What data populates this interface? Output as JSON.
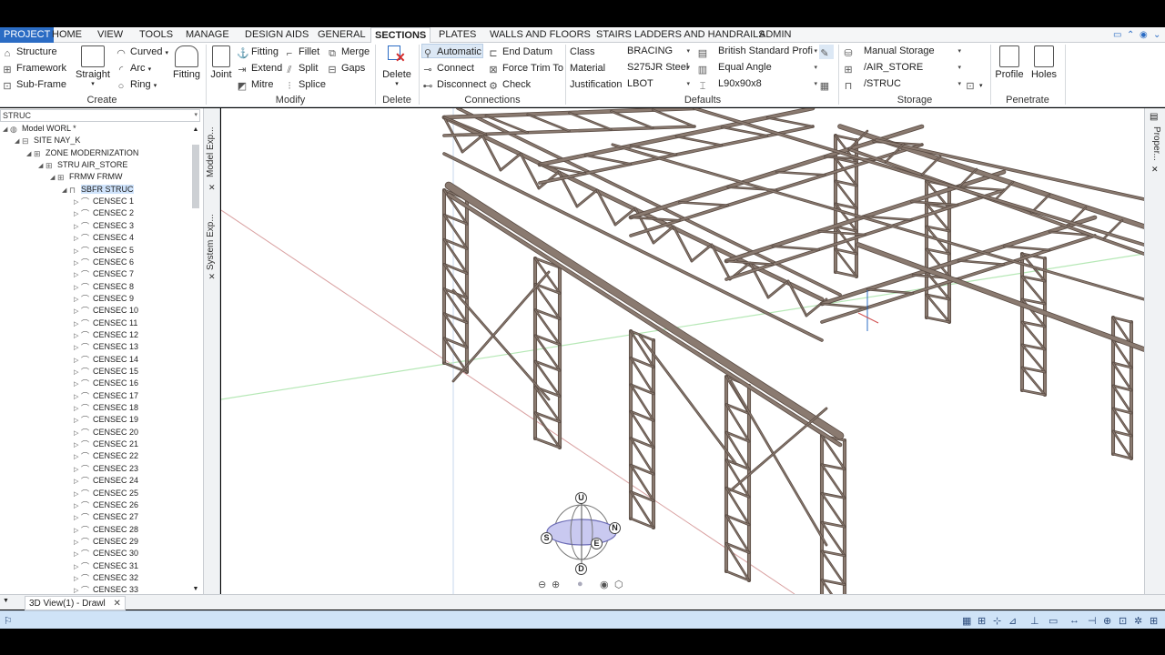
{
  "tabs": [
    {
      "label": "PROJECT",
      "state": "project"
    },
    {
      "label": "HOME",
      "state": ""
    },
    {
      "label": "VIEW",
      "state": ""
    },
    {
      "label": "TOOLS",
      "state": ""
    },
    {
      "label": "MANAGE",
      "state": ""
    },
    {
      "label": "DESIGN AIDS",
      "state": ""
    },
    {
      "label": "GENERAL",
      "state": ""
    },
    {
      "label": "SECTIONS",
      "state": "active"
    },
    {
      "label": "PLATES",
      "state": ""
    },
    {
      "label": "WALLS AND FLOORS",
      "state": ""
    },
    {
      "label": "STAIRS LADDERS AND HANDRAILS",
      "state": ""
    },
    {
      "label": "ADMIN",
      "state": ""
    }
  ],
  "ribbon": {
    "create": {
      "label": "Create",
      "structure": "Structure",
      "framework": "Framework",
      "subframe": "Sub-Frame",
      "straight": "Straight",
      "curved": "Curved",
      "arc": "Arc",
      "ring": "Ring",
      "fitting_big": "Fitting"
    },
    "modify": {
      "label": "Modify",
      "joint": "Joint",
      "fitting": "Fitting",
      "extend": "Extend",
      "mitre": "Mitre",
      "fillet": "Fillet",
      "split": "Split",
      "splice": "Splice",
      "merge": "Merge",
      "gaps": "Gaps"
    },
    "delete": {
      "label": "Delete",
      "button": "Delete"
    },
    "connections": {
      "label": "Connections",
      "automatic": "Automatic",
      "connect": "Connect",
      "disconnect": "Disconnect",
      "end_datum": "End Datum",
      "force_trim": "Force Trim To",
      "check": "Check"
    },
    "defaults": {
      "label": "Defaults",
      "class_label": "Class",
      "class_value": "BRACING",
      "material_label": "Material",
      "material_value": "S275JR Steel",
      "justification_label": "Justification",
      "justification_value": "LBOT",
      "profile_std": "British Standard Profi",
      "profile_type": "Equal Angle",
      "profile_size": "L90x90x8"
    },
    "storage": {
      "label": "Storage",
      "mode": "Manual Storage",
      "store": "/AIR_STORE",
      "struc": "/STRUC"
    },
    "penetrate": {
      "label": "Penetrate",
      "profile": "Profile",
      "holes": "Holes"
    }
  },
  "explorer": {
    "filter": "STRUC",
    "tree": [
      {
        "label": "Model WORL *",
        "level": 0,
        "exp": "◢",
        "icon": "globe"
      },
      {
        "label": "SITE NAY_K",
        "level": 1,
        "exp": "◢",
        "icon": "site"
      },
      {
        "label": "ZONE MODERNIZATION",
        "level": 2,
        "exp": "◢",
        "icon": "zone"
      },
      {
        "label": "STRU AIR_STORE",
        "level": 3,
        "exp": "◢",
        "icon": "stru"
      },
      {
        "label": "FRMW FRMW",
        "level": 4,
        "exp": "◢",
        "icon": "frmw"
      },
      {
        "label": "SBFR STRUC",
        "level": 5,
        "exp": "◢",
        "icon": "sbfr",
        "selected": true
      },
      {
        "label": "CENSEC 1",
        "level": 6,
        "exp": "▷",
        "icon": "sec"
      },
      {
        "label": "CENSEC 2",
        "level": 6,
        "exp": "▷",
        "icon": "sec"
      },
      {
        "label": "CENSEC 3",
        "level": 6,
        "exp": "▷",
        "icon": "sec"
      },
      {
        "label": "CENSEC 4",
        "level": 6,
        "exp": "▷",
        "icon": "sec"
      },
      {
        "label": "CENSEC 5",
        "level": 6,
        "exp": "▷",
        "icon": "sec"
      },
      {
        "label": "CENSEC 6",
        "level": 6,
        "exp": "▷",
        "icon": "sec"
      },
      {
        "label": "CENSEC 7",
        "level": 6,
        "exp": "▷",
        "icon": "sec"
      },
      {
        "label": "CENSEC 8",
        "level": 6,
        "exp": "▷",
        "icon": "sec"
      },
      {
        "label": "CENSEC 9",
        "level": 6,
        "exp": "▷",
        "icon": "sec"
      },
      {
        "label": "CENSEC 10",
        "level": 6,
        "exp": "▷",
        "icon": "sec"
      },
      {
        "label": "CENSEC 11",
        "level": 6,
        "exp": "▷",
        "icon": "sec"
      },
      {
        "label": "CENSEC 12",
        "level": 6,
        "exp": "▷",
        "icon": "sec"
      },
      {
        "label": "CENSEC 13",
        "level": 6,
        "exp": "▷",
        "icon": "sec"
      },
      {
        "label": "CENSEC 14",
        "level": 6,
        "exp": "▷",
        "icon": "sec"
      },
      {
        "label": "CENSEC 15",
        "level": 6,
        "exp": "▷",
        "icon": "sec"
      },
      {
        "label": "CENSEC 16",
        "level": 6,
        "exp": "▷",
        "icon": "sec"
      },
      {
        "label": "CENSEC 17",
        "level": 6,
        "exp": "▷",
        "icon": "sec"
      },
      {
        "label": "CENSEC 18",
        "level": 6,
        "exp": "▷",
        "icon": "sec"
      },
      {
        "label": "CENSEC 19",
        "level": 6,
        "exp": "▷",
        "icon": "sec"
      },
      {
        "label": "CENSEC 20",
        "level": 6,
        "exp": "▷",
        "icon": "sec"
      },
      {
        "label": "CENSEC 21",
        "level": 6,
        "exp": "▷",
        "icon": "sec"
      },
      {
        "label": "CENSEC 22",
        "level": 6,
        "exp": "▷",
        "icon": "sec"
      },
      {
        "label": "CENSEC 23",
        "level": 6,
        "exp": "▷",
        "icon": "sec"
      },
      {
        "label": "CENSEC 24",
        "level": 6,
        "exp": "▷",
        "icon": "sec"
      },
      {
        "label": "CENSEC 25",
        "level": 6,
        "exp": "▷",
        "icon": "sec"
      },
      {
        "label": "CENSEC 26",
        "level": 6,
        "exp": "▷",
        "icon": "sec"
      },
      {
        "label": "CENSEC 27",
        "level": 6,
        "exp": "▷",
        "icon": "sec"
      },
      {
        "label": "CENSEC 28",
        "level": 6,
        "exp": "▷",
        "icon": "sec"
      },
      {
        "label": "CENSEC 29",
        "level": 6,
        "exp": "▷",
        "icon": "sec"
      },
      {
        "label": "CENSEC 30",
        "level": 6,
        "exp": "▷",
        "icon": "sec"
      },
      {
        "label": "CENSEC 31",
        "level": 6,
        "exp": "▷",
        "icon": "sec"
      },
      {
        "label": "CENSEC 32",
        "level": 6,
        "exp": "▷",
        "icon": "sec"
      },
      {
        "label": "CENSEC 33",
        "level": 6,
        "exp": "▷",
        "icon": "sec"
      }
    ]
  },
  "sidetabs": {
    "model_explorer": "Model Exp...",
    "system_explorer": "System Exp..."
  },
  "rightbar": {
    "properties": "Proper..."
  },
  "viewcube": {
    "u": "U",
    "n": "N",
    "s": "S",
    "e": "E",
    "d": "D"
  },
  "doc_tab": {
    "label": "3D View(1) - Drawl",
    "close": "✕"
  },
  "colors": {
    "accent": "#2b6cc4",
    "steel": "#8a7a70",
    "steel_dark": "#5a4c44",
    "status_bar": "#cfe3f7"
  }
}
